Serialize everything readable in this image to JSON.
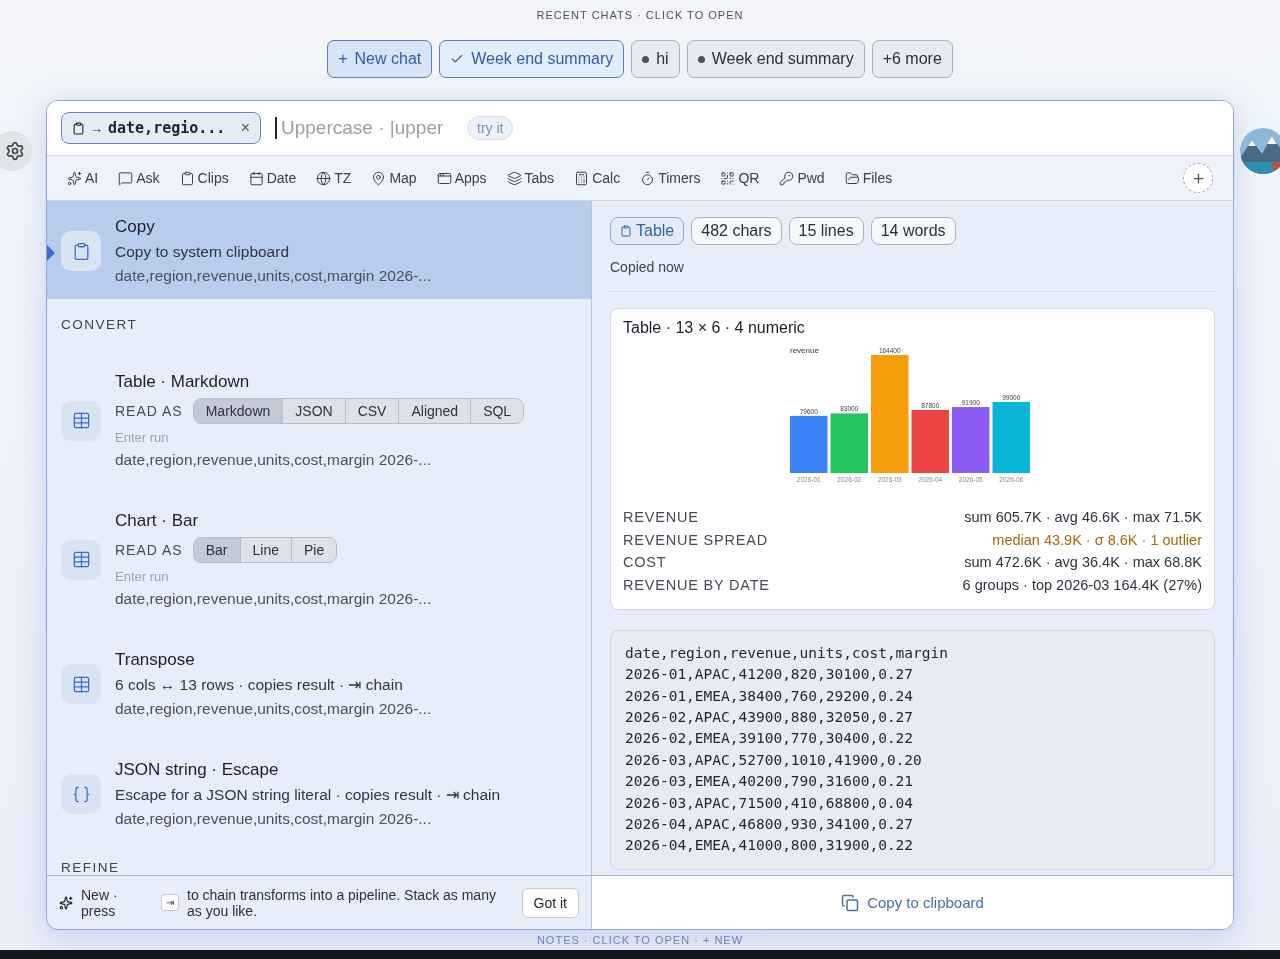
{
  "recent_chats": {
    "heading": "RECENT CHATS · CLICK TO OPEN",
    "chips": [
      {
        "kind": "new",
        "label": "New chat",
        "icon": "+"
      },
      {
        "kind": "current",
        "label": "Week end summary"
      },
      {
        "kind": "dot",
        "label": "hi"
      },
      {
        "kind": "dot",
        "label": "Week end summary"
      },
      {
        "kind": "more",
        "label": "+6 more"
      }
    ]
  },
  "search": {
    "source_chip": {
      "label": "date,regio...",
      "arrow": "→",
      "close": "×"
    },
    "placeholder": "Uppercase · |upper",
    "hint": "try it"
  },
  "toolbar": [
    {
      "label": "AI"
    },
    {
      "label": "Ask"
    },
    {
      "label": "Clips"
    },
    {
      "label": "Date"
    },
    {
      "label": "TZ"
    },
    {
      "label": "Map"
    },
    {
      "label": "Apps"
    },
    {
      "label": "Tabs"
    },
    {
      "label": "Calc"
    },
    {
      "label": "Timers"
    },
    {
      "label": "QR"
    },
    {
      "label": "Pwd"
    },
    {
      "label": "Files"
    }
  ],
  "results": [
    {
      "kind": "action",
      "selected": true,
      "title": "Copy",
      "subtitle": "Copy to system clipboard",
      "preview": "date,region,revenue,units,cost,margin 2026-..."
    },
    {
      "kind": "section",
      "title": "CONVERT"
    },
    {
      "kind": "action",
      "selected": false,
      "title": "Table · Markdown",
      "read_as_label": "READ AS",
      "read_as": [
        {
          "label": "Markdown",
          "selected": true
        },
        {
          "label": "JSON",
          "selected": false
        },
        {
          "label": "CSV",
          "selected": false
        },
        {
          "label": "Aligned",
          "selected": false
        },
        {
          "label": "SQL",
          "selected": false
        }
      ],
      "hint": "Enter run",
      "preview": "date,region,revenue,units,cost,margin 2026-..."
    },
    {
      "kind": "action",
      "selected": false,
      "title": "Chart · Bar",
      "read_as_label": "READ AS",
      "read_as": [
        {
          "label": "Bar",
          "selected": true
        },
        {
          "label": "Line",
          "selected": false
        },
        {
          "label": "Pie",
          "selected": false
        }
      ],
      "hint": "Enter run",
      "preview": "date,region,revenue,units,cost,margin 2026-..."
    },
    {
      "kind": "action",
      "selected": false,
      "title": "Transpose",
      "subtitle": "6 cols ↔ 13 rows · copies result · ⇥ chain",
      "preview": "date,region,revenue,units,cost,margin 2026-..."
    },
    {
      "kind": "action",
      "selected": false,
      "title": "JSON string · Escape",
      "subtitle": "Escape for a JSON string literal · copies result · ⇥ chain",
      "preview": "date,region,revenue,units,cost,margin 2026-..."
    },
    {
      "kind": "section",
      "title": "REFINE"
    }
  ],
  "tip": {
    "lead": "New · press",
    "key": "⇥",
    "text": "to chain transforms into a pipeline. Stack as many as you like.",
    "button": "Got it"
  },
  "preview": {
    "pills": [
      {
        "kind": "type",
        "label": "Table"
      },
      {
        "kind": "stat",
        "label": "482 chars"
      },
      {
        "kind": "stat",
        "label": "15 lines"
      },
      {
        "kind": "stat",
        "label": "14 words"
      }
    ],
    "status": "Copied now",
    "card": {
      "title": "Table · 13 × 6 · 4 numeric",
      "chart_data": {
        "type": "bar",
        "title": "revenue",
        "categories": [
          "2026-01",
          "2026-02",
          "2026-03",
          "2026-04",
          "2026-05",
          "2026-06"
        ],
        "values": [
          79600,
          83000,
          164400,
          87800,
          91900,
          99000
        ],
        "data_labels": true
      },
      "stats": [
        {
          "label": "REVENUE",
          "value": "sum 605.7K · avg 46.6K · max 71.5K",
          "warning": false
        },
        {
          "label": "REVENUE SPREAD",
          "value": "median 43.9K · σ 8.6K · 1 outlier",
          "warning": true
        },
        {
          "label": "COST",
          "value": "sum 472.6K · avg 36.4K · max 68.8K",
          "warning": false
        },
        {
          "label": "REVENUE BY DATE",
          "value": "6 groups · top 2026-03 164.4K (27%)",
          "warning": false
        }
      ]
    },
    "code_lines": [
      "date,region,revenue,units,cost,margin",
      "2026-01,APAC,41200,820,30100,0.27",
      "2026-01,EMEA,38400,760,29200,0.24",
      "2026-02,APAC,43900,880,32050,0.27",
      "2026-02,EMEA,39100,770,30400,0.22",
      "2026-03,APAC,52700,1010,41900,0.20",
      "2026-03,EMEA,40200,790,31600,0.21",
      "2026-03,APAC,71500,410,68800,0.04",
      "2026-04,APAC,46800,930,34100,0.27",
      "2026-04,EMEA,41000,800,31900,0.22"
    ],
    "copy_button": "Copy to clipboard"
  },
  "notes_bar": "NOTES · CLICK TO OPEN · + NEW"
}
